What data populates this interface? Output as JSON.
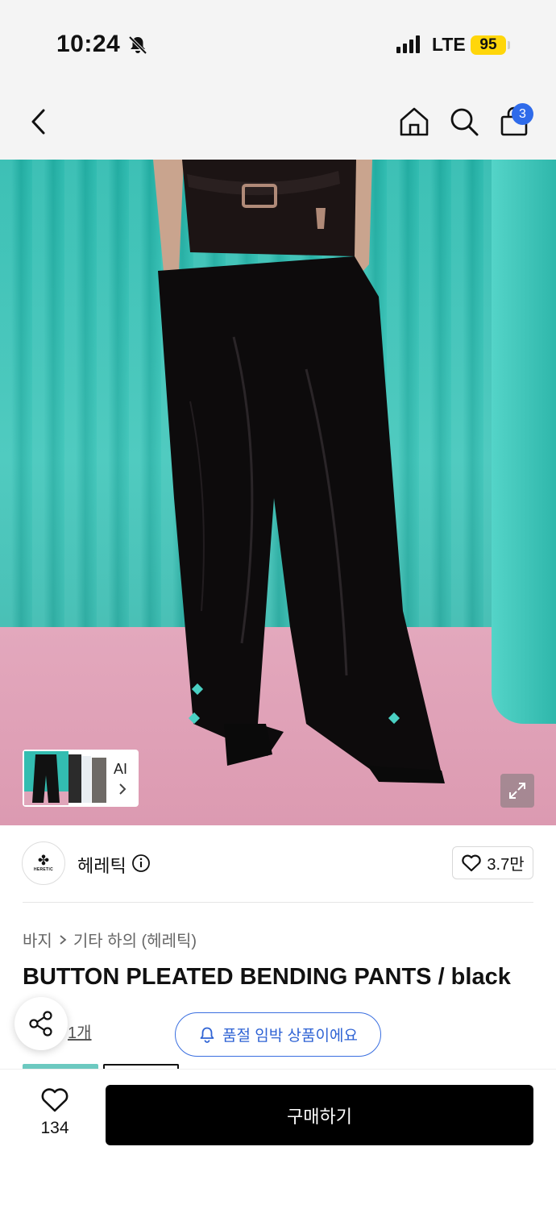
{
  "status_bar": {
    "time": "10:24",
    "network": "LTE",
    "battery": "95",
    "icons": [
      "bell-slash-icon",
      "signal-bars-icon"
    ]
  },
  "nav": {
    "icons": [
      "chevron-left-icon",
      "home-icon",
      "search-icon",
      "shopping-bag-icon"
    ],
    "cart_count": "3"
  },
  "gallery": {
    "ai_label": "AI",
    "colors": {
      "curtain": "#3cc5b9",
      "floor": "#e3a8bd"
    }
  },
  "brand": {
    "name": "헤레틱",
    "logo_text": "HERETIC",
    "like_count": "3.7만"
  },
  "product": {
    "breadcrumb": [
      "바지",
      "기타 하의 (헤레틱)"
    ],
    "title": "BUTTON PLEATED BENDING PANTS / black",
    "partial_count": "1개"
  },
  "notice": {
    "soldout_text": "품절 임박 상품이에요",
    "accent": "#2f63d4"
  },
  "bottom_bar": {
    "wish_count": "134",
    "buy_label": "구매하기"
  }
}
